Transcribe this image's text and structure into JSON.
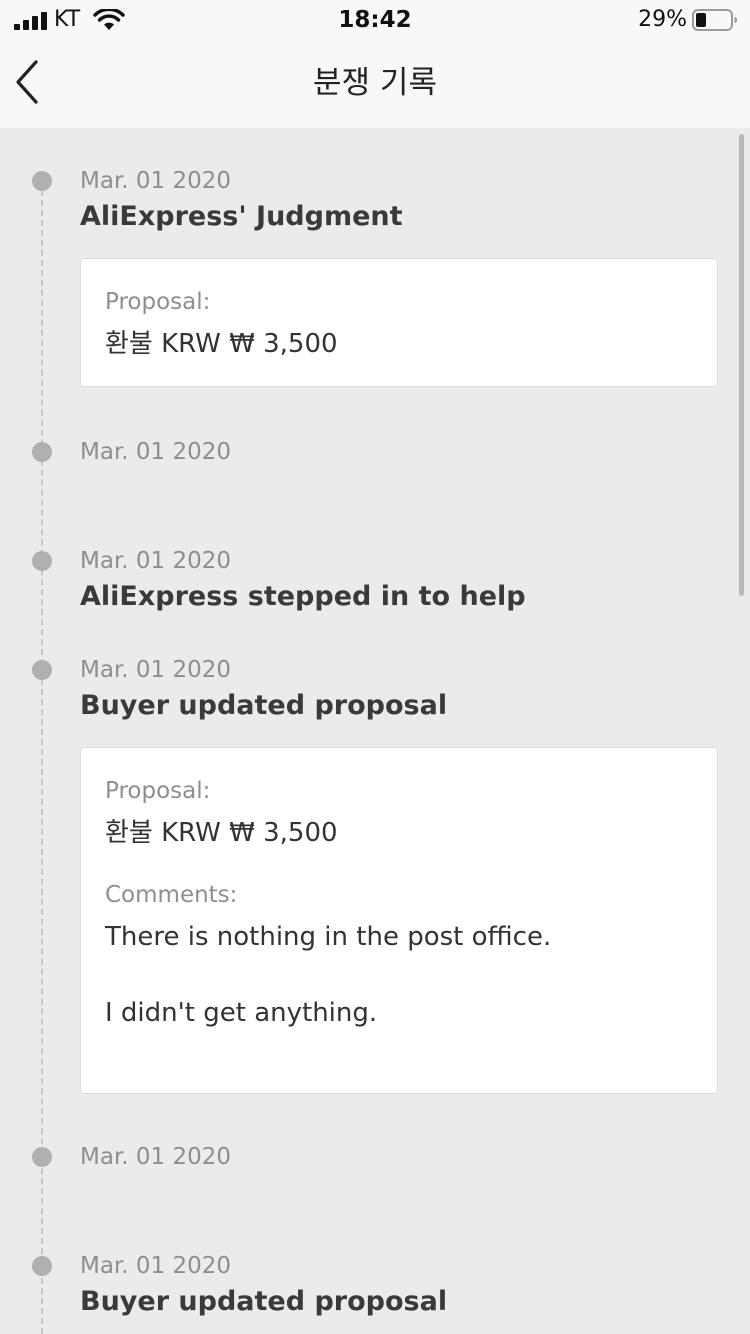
{
  "status_bar": {
    "carrier": "KT",
    "time": "18:42",
    "battery_percent": "29%",
    "battery_level": 0.29,
    "icons": [
      "signal-icon",
      "wifi-icon",
      "battery-icon"
    ]
  },
  "nav": {
    "title": "분쟁 기록",
    "back_icon": "chevron-left-icon"
  },
  "colors": {
    "background": "#ebebeb",
    "bar": "#f8f8f8",
    "card": "#ffffff",
    "timeline_dot": "#b0b0b0",
    "muted_text": "#8e8e8e",
    "title_text": "#3a3a3a"
  },
  "timeline": [
    {
      "date": "Mar. 01 2020",
      "title": "AliExpress' Judgment",
      "proposal_label": "Proposal:",
      "proposal_value": "환불 KRW ₩ 3,500"
    },
    {
      "date": "Mar. 01 2020",
      "title": ""
    },
    {
      "date": "Mar. 01 2020",
      "title": "AliExpress stepped in to help"
    },
    {
      "date": "Mar. 01 2020",
      "title": "Buyer updated proposal",
      "proposal_label": "Proposal:",
      "proposal_value": "환불 KRW ₩ 3,500",
      "comments_label": "Comments:",
      "comments": [
        "There is nothing in the post office.",
        "I didn't get anything."
      ]
    },
    {
      "date": "Mar. 01 2020",
      "title": ""
    },
    {
      "date": "Mar. 01 2020",
      "title": "Buyer updated proposal"
    }
  ]
}
